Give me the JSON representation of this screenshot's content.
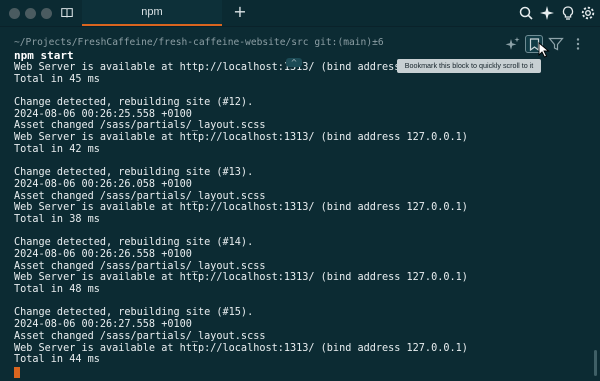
{
  "window": {
    "tab_title": "npm",
    "new_tab": "+"
  },
  "block": {
    "cwd": "~/Projects/FreshCaffeine/fresh-caffeine-website/src git:(main)±6",
    "command": "npm start",
    "bookmark_tooltip": "Bookmark this block to quickly scroll to it",
    "scroll_up": "^"
  },
  "output_lines": [
    "Web Server is available at http://localhost:1313/ (bind address 127.0.0.1)",
    "Total in 45 ms",
    "",
    "Change detected, rebuilding site (#12).",
    "2024-08-06 00:26:25.558 +0100",
    "Asset changed /sass/partials/_layout.scss",
    "Web Server is available at http://localhost:1313/ (bind address 127.0.0.1)",
    "Total in 42 ms",
    "",
    "Change detected, rebuilding site (#13).",
    "2024-08-06 00:26:26.058 +0100",
    "Asset changed /sass/partials/_layout.scss",
    "Web Server is available at http://localhost:1313/ (bind address 127.0.0.1)",
    "Total in 38 ms",
    "",
    "Change detected, rebuilding site (#14).",
    "2024-08-06 00:26:26.558 +0100",
    "Asset changed /sass/partials/_layout.scss",
    "Web Server is available at http://localhost:1313/ (bind address 127.0.0.1)",
    "Total in 48 ms",
    "",
    "Change detected, rebuilding site (#15).",
    "2024-08-06 00:26:27.558 +0100",
    "Asset changed /sass/partials/_layout.scss",
    "Web Server is available at http://localhost:1313/ (bind address 127.0.0.1)",
    "Total in 44 ms"
  ],
  "icons": {
    "titlebar_left": [
      "traffic-light-close",
      "traffic-light-minimize",
      "traffic-light-zoom",
      "book-icon"
    ],
    "titlebar_right": [
      "search-icon",
      "sparkle-icon",
      "lightbulb-icon",
      "gear-icon"
    ],
    "block_actions": [
      "sparkle-icon",
      "bookmark-icon",
      "filter-icon",
      "more-icon"
    ]
  },
  "colors": {
    "background": "#0c2b33",
    "accent": "#d9651f",
    "text": "#e9eef0",
    "muted": "#8c9ea4"
  }
}
